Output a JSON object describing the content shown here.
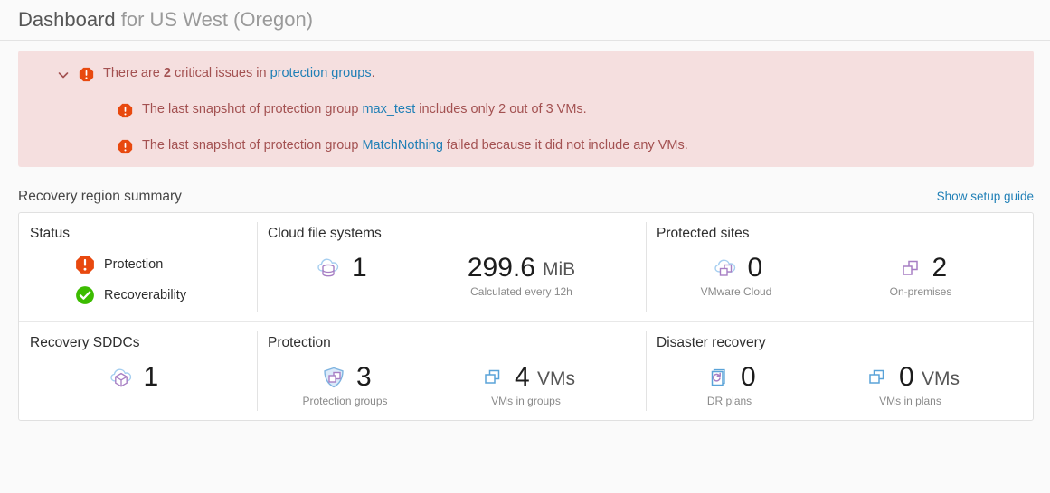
{
  "header": {
    "title_main": "Dashboard",
    "title_subject": " for US West (Oregon)"
  },
  "alert": {
    "chevron_icon": "chevron-down-icon",
    "severity_icon": "critical-octagon-icon",
    "summary": {
      "text_before": "There are ",
      "count": "2",
      "text_mid": " critical issues in ",
      "link": "protection groups",
      "text_after": "."
    },
    "issues": [
      {
        "text_before": "The last snapshot of protection group ",
        "link": "max_test",
        "text_after": " includes only 2 out of 3 VMs."
      },
      {
        "text_before": "The last snapshot of protection group ",
        "link": "MatchNothing",
        "text_after": " failed because it did not include any VMs."
      }
    ],
    "colors": {
      "background": "#f5dfdf",
      "text": "#a35151",
      "link": "#1f7fb6",
      "icon": "#e8490f"
    }
  },
  "section": {
    "title": "Recovery region summary",
    "setup_link": "Show setup guide"
  },
  "summary": {
    "status": {
      "title": "Status",
      "items": [
        {
          "label": "Protection",
          "icon": "critical-octagon-icon",
          "color": "#e8490f"
        },
        {
          "label": "Recoverability",
          "icon": "success-check-circle-icon",
          "color": "#3cbc00"
        }
      ]
    },
    "cloud_file_systems": {
      "title": "Cloud file systems",
      "count": {
        "icon": "cloud-database-icon",
        "value": "1",
        "unit": "",
        "caption": ""
      },
      "size": {
        "icon": "",
        "value": "299.6",
        "unit": "MiB",
        "caption": "Calculated every 12h"
      }
    },
    "protected_sites": {
      "title": "Protected sites",
      "vmware_cloud": {
        "icon": "cloud-sites-icon",
        "value": "0",
        "caption": "VMware Cloud"
      },
      "on_premises": {
        "icon": "sites-icon",
        "value": "2",
        "caption": "On-premises"
      }
    },
    "recovery_sddcs": {
      "title": "Recovery SDDCs",
      "sddc": {
        "icon": "cloud-cube-icon",
        "value": "1",
        "caption": ""
      }
    },
    "protection": {
      "title": "Protection",
      "groups": {
        "icon": "shield-groups-icon",
        "value": "3",
        "caption": "Protection groups"
      },
      "vms": {
        "icon": "vms-icon",
        "value": "4",
        "unit": "VMs",
        "caption": "VMs in groups"
      }
    },
    "disaster_recovery": {
      "title": "Disaster recovery",
      "plans": {
        "icon": "dr-plan-icon",
        "value": "0",
        "caption": "DR plans"
      },
      "vms": {
        "icon": "vms-icon",
        "value": "0",
        "unit": "VMs",
        "caption": "VMs in plans"
      }
    }
  }
}
